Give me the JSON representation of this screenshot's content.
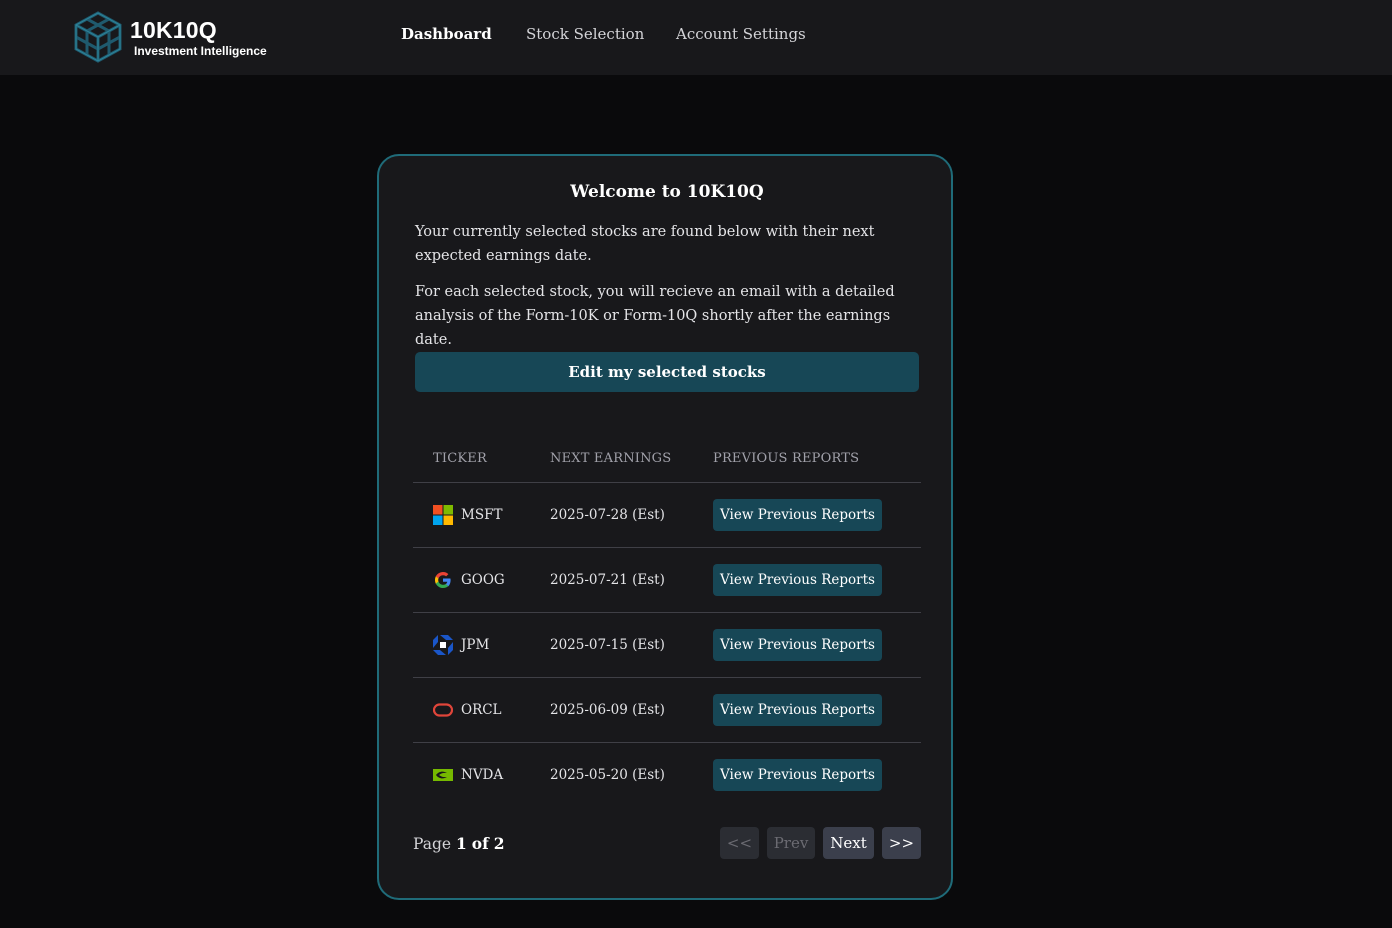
{
  "header": {
    "brand_name": "10K10Q",
    "brand_tagline": "Investment Intelligence",
    "nav": [
      {
        "label": "Dashboard",
        "active": true
      },
      {
        "label": "Stock Selection",
        "active": false
      },
      {
        "label": "Account Settings",
        "active": false
      }
    ]
  },
  "main": {
    "title": "Welcome to 10K10Q",
    "intro_1": "Your currently selected stocks are found below with their next expected earnings date.",
    "intro_2": "For each selected stock, you will recieve an email with a detailed analysis of the Form-10K or Form-10Q shortly after the earnings date.",
    "edit_button": "Edit my selected stocks",
    "table": {
      "headers": [
        "TICKER",
        "NEXT EARNINGS",
        "PREVIOUS REPORTS"
      ],
      "rows": [
        {
          "icon": "microsoft-icon",
          "ticker": "MSFT",
          "next_earnings": "2025-07-28 (Est)",
          "action": "View Previous Reports"
        },
        {
          "icon": "google-icon",
          "ticker": "GOOG",
          "next_earnings": "2025-07-21 (Est)",
          "action": "View Previous Reports"
        },
        {
          "icon": "chase-icon",
          "ticker": "JPM",
          "next_earnings": "2025-07-15 (Est)",
          "action": "View Previous Reports"
        },
        {
          "icon": "oracle-icon",
          "ticker": "ORCL",
          "next_earnings": "2025-06-09 (Est)",
          "action": "View Previous Reports"
        },
        {
          "icon": "nvidia-icon",
          "ticker": "NVDA",
          "next_earnings": "2025-05-20 (Est)",
          "action": "View Previous Reports"
        }
      ]
    },
    "pagination": {
      "label": "Page",
      "current": "1",
      "of": "of",
      "total": "2",
      "first": "<<",
      "prev": "Prev",
      "next": "Next",
      "last": ">>"
    }
  },
  "colors": {
    "background": "#0a0a0c",
    "topbar": "#18181b",
    "card": "#18181b",
    "card_border": "#1f6b79",
    "button": "#174756"
  }
}
